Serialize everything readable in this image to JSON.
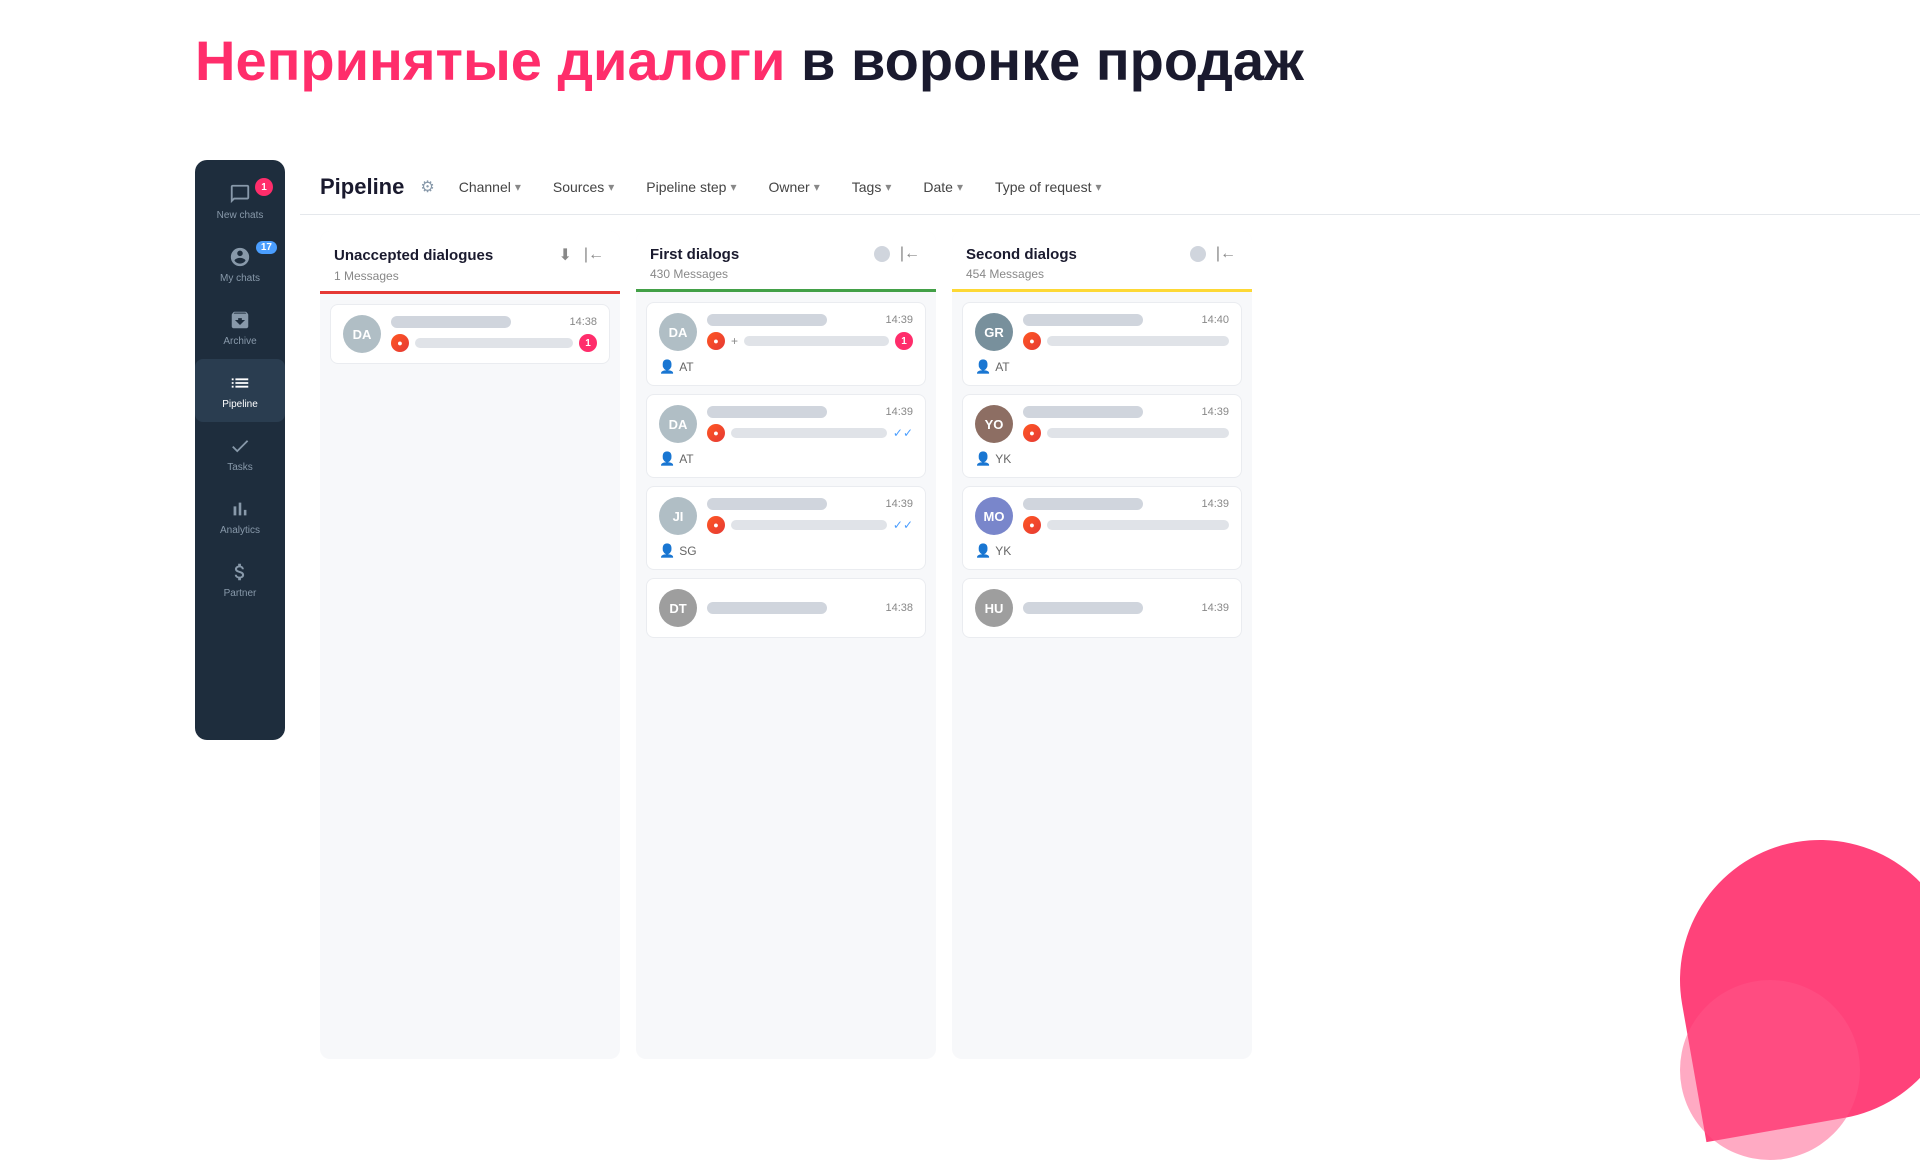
{
  "title": {
    "part1": "Непринятые диалоги",
    "part2": "в воронке продаж"
  },
  "sidebar": {
    "items": [
      {
        "id": "new-chats",
        "label": "New chats",
        "badge": "1",
        "badgeType": "red"
      },
      {
        "id": "my-chats",
        "label": "My chats",
        "badge": "17",
        "badgeType": "blue"
      },
      {
        "id": "archive",
        "label": "Archive",
        "badge": "",
        "badgeType": ""
      },
      {
        "id": "pipeline",
        "label": "Pipeline",
        "badge": "",
        "badgeType": "",
        "active": true
      },
      {
        "id": "tasks",
        "label": "Tasks",
        "badge": "",
        "badgeType": ""
      },
      {
        "id": "analytics",
        "label": "Analytics",
        "badge": "",
        "badgeType": ""
      },
      {
        "id": "partner",
        "label": "Partner",
        "badge": "",
        "badgeType": ""
      }
    ]
  },
  "toolbar": {
    "title": "Pipeline",
    "filters": [
      {
        "label": "Channel"
      },
      {
        "label": "Sources"
      },
      {
        "label": "Pipeline step"
      },
      {
        "label": "Owner"
      },
      {
        "label": "Tags"
      },
      {
        "label": "Date"
      },
      {
        "label": "Type of request"
      }
    ]
  },
  "columns": [
    {
      "id": "unaccepted",
      "title": "Unaccepted dialogues",
      "messages": "1 Messages",
      "borderColor": "red-border",
      "cards": [
        {
          "avatar": "DA",
          "time": "14:38",
          "badge": "1",
          "hasPlus": false,
          "checkmark": false,
          "owner": ""
        }
      ]
    },
    {
      "id": "first",
      "title": "First dialogs",
      "messages": "430 Messages",
      "borderColor": "green-border",
      "cards": [
        {
          "avatar": "DA",
          "time": "14:39",
          "badge": "1",
          "hasPlus": true,
          "checkmark": false,
          "owner": "AT"
        },
        {
          "avatar": "DA",
          "time": "14:39",
          "badge": "",
          "hasPlus": false,
          "checkmark": true,
          "owner": "AT"
        },
        {
          "avatar": "JI",
          "time": "14:39",
          "badge": "",
          "hasPlus": false,
          "checkmark": true,
          "owner": "SG"
        },
        {
          "avatar": "DT",
          "time": "14:38",
          "badge": "",
          "hasPlus": false,
          "checkmark": false,
          "owner": ""
        }
      ]
    },
    {
      "id": "second",
      "title": "Second dialogs",
      "messages": "454 Messages",
      "borderColor": "yellow-border",
      "cards": [
        {
          "avatar": "GR",
          "time": "14:40",
          "badge": "",
          "hasPlus": false,
          "checkmark": false,
          "owner": "AT"
        },
        {
          "avatar": "YO",
          "time": "14:39",
          "badge": "",
          "hasPlus": false,
          "checkmark": false,
          "owner": "YK"
        },
        {
          "avatar": "MO",
          "time": "14:39",
          "badge": "",
          "hasPlus": false,
          "checkmark": false,
          "owner": "YK"
        },
        {
          "avatar": "HU",
          "time": "14:39",
          "badge": "",
          "hasPlus": false,
          "checkmark": false,
          "owner": ""
        }
      ]
    }
  ]
}
